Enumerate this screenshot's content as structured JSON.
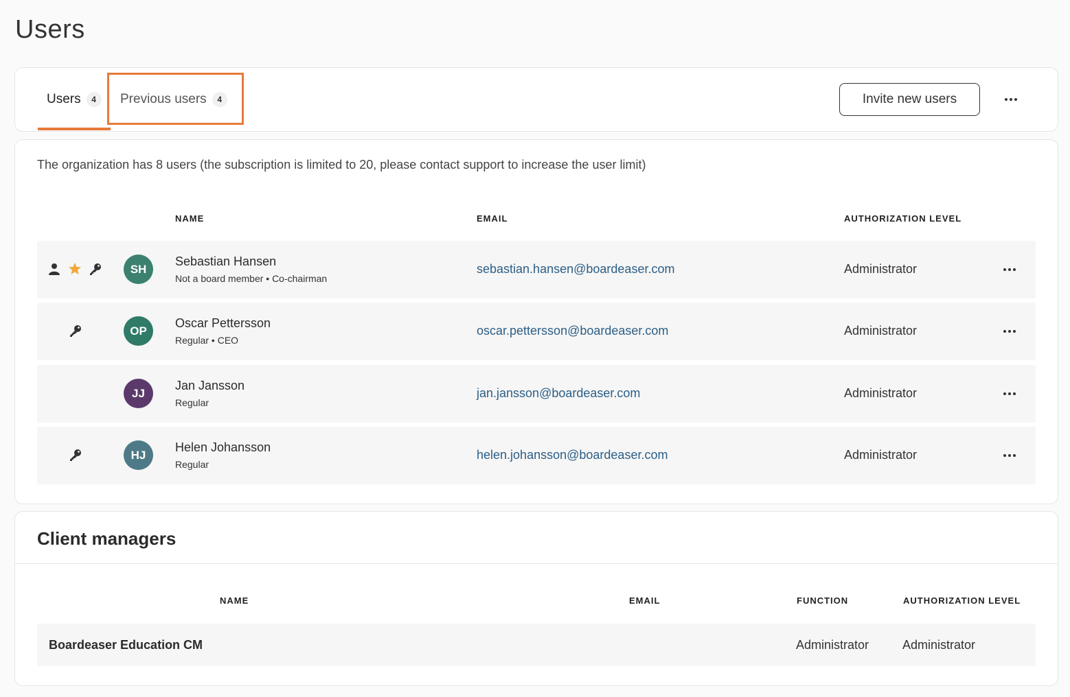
{
  "page": {
    "title": "Users"
  },
  "tabs": [
    {
      "label": "Users",
      "count": "4",
      "active": true
    },
    {
      "label": "Previous users",
      "count": "4",
      "active": false
    }
  ],
  "toolbar": {
    "invite_label": "Invite new users"
  },
  "users_section": {
    "note": "The organization has 8 users (the subscription is limited to 20, please contact support to increase the user limit)",
    "columns": {
      "name": "NAME",
      "email": "EMAIL",
      "auth": "AUTHORIZATION LEVEL"
    },
    "rows": [
      {
        "initials": "SH",
        "avatar_color": "#3c8070",
        "name": "Sebastian Hansen",
        "role": "Not a board member • Co-chairman",
        "email": "sebastian.hansen@boardeaser.com",
        "auth": "Administrator",
        "icons": [
          "person-icon",
          "star-icon",
          "key-icon"
        ]
      },
      {
        "initials": "OP",
        "avatar_color": "#2f7a68",
        "name": "Oscar Pettersson",
        "role": "Regular • CEO",
        "email": "oscar.pettersson@boardeaser.com",
        "auth": "Administrator",
        "icons": [
          "key-icon"
        ]
      },
      {
        "initials": "JJ",
        "avatar_color": "#5b3a6b",
        "name": "Jan Jansson",
        "role": "Regular",
        "email": "jan.jansson@boardeaser.com",
        "auth": "Administrator",
        "icons": []
      },
      {
        "initials": "HJ",
        "avatar_color": "#4e7a88",
        "name": "Helen Johansson",
        "role": "Regular",
        "email": "helen.johansson@boardeaser.com",
        "auth": "Administrator",
        "icons": [
          "key-icon"
        ]
      }
    ]
  },
  "client_managers": {
    "title": "Client managers",
    "columns": {
      "name": "NAME",
      "email": "EMAIL",
      "function": "FUNCTION",
      "auth": "AUTHORIZATION LEVEL"
    },
    "rows": [
      {
        "name": "Boardeaser Education CM",
        "email": "",
        "function": "Administrator",
        "auth": "Administrator"
      }
    ]
  },
  "colors": {
    "accent": "#e87a3a",
    "link": "#2c5e85",
    "star": "#f0a93a"
  }
}
